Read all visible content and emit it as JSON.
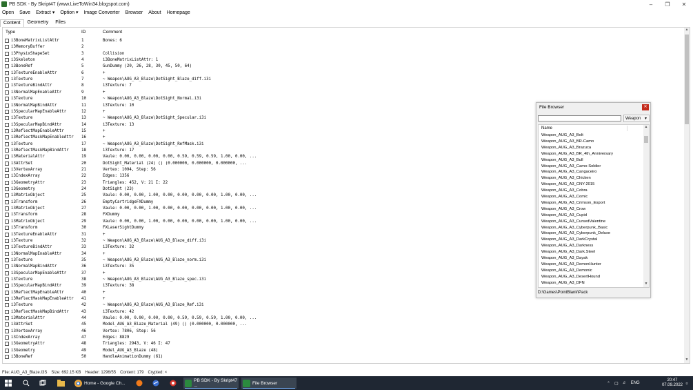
{
  "window": {
    "title": "PB SDK - By Skript47 (www.LiveToWin34.blogspot.com)"
  },
  "menu": [
    "Open",
    "Save",
    "Extract",
    "Option",
    "Image Converter",
    "Browser",
    "About",
    "Homepage"
  ],
  "tabs": [
    "Content",
    "Geometry",
    "Files"
  ],
  "columns": {
    "type": "Type",
    "id": "ID",
    "comment": "Comment"
  },
  "rows": [
    {
      "type": "i3BoneMatrixListAttr",
      "id": "1",
      "comment": "Bones: 6"
    },
    {
      "type": "i3MemoryBuffer",
      "id": "2",
      "comment": ""
    },
    {
      "type": "i3PhysixShapeSet",
      "id": "3",
      "comment": "Collision"
    },
    {
      "type": "i3Skeleton",
      "id": "4",
      "comment": "i3BoneMatrixListAttr: 1"
    },
    {
      "type": "i3BoneRef",
      "id": "5",
      "comment": "GunDummy (20, 26, 28, 30, 45, 50, 64)"
    },
    {
      "type": "i3TextureEnableAttr",
      "id": "6",
      "comment": "+"
    },
    {
      "type": "i3Texture",
      "id": "7",
      "comment": "~ Weapon\\AUG_A3_Blaze\\DotSight_Blaze_diff.i3i"
    },
    {
      "type": "i3TextureBindAttr",
      "id": "8",
      "comment": "i3Texture: 7"
    },
    {
      "type": "i3NormalMapEnableAttr",
      "id": "9",
      "comment": "+"
    },
    {
      "type": "i3Texture",
      "id": "10",
      "comment": "~ Weapon\\AUG_A3_Blaze\\DotSight_Normal.i3i"
    },
    {
      "type": "i3NormalMapBindAttr",
      "id": "11",
      "comment": "i3Texture: 10"
    },
    {
      "type": "i3SpecularMapEnableAttr",
      "id": "12",
      "comment": "+"
    },
    {
      "type": "i3Texture",
      "id": "13",
      "comment": "~ Weapon\\AUG_A3_Blaze\\DotSight_Specular.i3i"
    },
    {
      "type": "i3SpecularMapBindAttr",
      "id": "14",
      "comment": "i3Texture: 13"
    },
    {
      "type": "i3ReflectMapEnableAttr",
      "id": "15",
      "comment": "+"
    },
    {
      "type": "i3ReflectMaskMapEnableAttr",
      "id": "16",
      "comment": "+"
    },
    {
      "type": "i3Texture",
      "id": "17",
      "comment": "~ Weapon\\AUG_A3_Blaze\\DotSight_RefMask.i3i"
    },
    {
      "type": "i3ReflectMaskMapBindAttr",
      "id": "18",
      "comment": "i3Texture: 17"
    },
    {
      "type": "i3MaterialAttr",
      "id": "19",
      "comment": "Vaule: 0.00, 0.00, 0.00, 0.00, 0.59, 0.59, 0.59, 1.00, 0.00, ..."
    },
    {
      "type": "i3AttrSet",
      "id": "20",
      "comment": "DotSight_Material (24) () (0.000000, 0.000000, 0.000000, ..."
    },
    {
      "type": "i3VertexArray",
      "id": "21",
      "comment": "Vertex: 1094, Step: 56"
    },
    {
      "type": "i3IndexArray",
      "id": "22",
      "comment": "Edges: 1356"
    },
    {
      "type": "i3GeometryAttr",
      "id": "23",
      "comment": "Triangles: 452, V: 21 I: 22"
    },
    {
      "type": "i3Geometry",
      "id": "24",
      "comment": "DotSight (23)"
    },
    {
      "type": "i3MatrixObject",
      "id": "25",
      "comment": "Vaule: 0.00, 0.00, 1.00, 0.00, 0.00, 0.00, 0.00, 1.00, 0.00, ..."
    },
    {
      "type": "i3Transform",
      "id": "26",
      "comment": "EmptyCartridgeFXDummy"
    },
    {
      "type": "i3MatrixObject",
      "id": "27",
      "comment": "Vaule: 0.00, 0.00, 1.00, 0.00, 0.00, 0.00, 0.00, 1.00, 0.00, ..."
    },
    {
      "type": "i3Transform",
      "id": "28",
      "comment": "FXDummy"
    },
    {
      "type": "i3MatrixObject",
      "id": "29",
      "comment": "Vaule: 0.00, 0.00, 1.00, 0.00, 0.00, 0.00, 0.00, 1.00, 0.00, ..."
    },
    {
      "type": "i3Transform",
      "id": "30",
      "comment": "FXLaserSightDummy"
    },
    {
      "type": "i3TextureEnableAttr",
      "id": "31",
      "comment": "+"
    },
    {
      "type": "i3Texture",
      "id": "32",
      "comment": "~ Weapon\\AUG_A3_Blaze\\AUG_A3_Blaze_diff.i3i"
    },
    {
      "type": "i3TextureBindAttr",
      "id": "33",
      "comment": "i3Texture: 32"
    },
    {
      "type": "i3NormalMapEnableAttr",
      "id": "34",
      "comment": "+"
    },
    {
      "type": "i3Texture",
      "id": "35",
      "comment": "~ Weapon\\AUG_A3_Blaze\\AUG_A3_Blaze_norm.i3i"
    },
    {
      "type": "i3NormalMapBindAttr",
      "id": "36",
      "comment": "i3Texture: 35"
    },
    {
      "type": "i3SpecularMapEnableAttr",
      "id": "37",
      "comment": "+"
    },
    {
      "type": "i3Texture",
      "id": "38",
      "comment": "~ Weapon\\AUG_A3_Blaze\\AUG_A3_Blaze_spec.i3i"
    },
    {
      "type": "i3SpecularMapBindAttr",
      "id": "39",
      "comment": "i3Texture: 38"
    },
    {
      "type": "i3ReflectMapEnableAttr",
      "id": "40",
      "comment": "+"
    },
    {
      "type": "i3ReflectMaskMapEnableAttr",
      "id": "41",
      "comment": "+"
    },
    {
      "type": "i3Texture",
      "id": "42",
      "comment": "~ Weapon\\AUG_A3_Blaze\\AUG_A3_Blaze_Ref.i3i"
    },
    {
      "type": "i3ReflectMaskMapBindAttr",
      "id": "43",
      "comment": "i3Texture: 42"
    },
    {
      "type": "i3MaterialAttr",
      "id": "44",
      "comment": "Vaule: 0.00, 0.00, 0.00, 0.00, 0.59, 0.59, 0.59, 1.00, 0.00, ..."
    },
    {
      "type": "i3AttrSet",
      "id": "45",
      "comment": "Model_AUG_A3_Blaze_Material (49) () (0.000000, 0.000000, ..."
    },
    {
      "type": "i3VertexArray",
      "id": "46",
      "comment": "Vertex: 7806, Step: 56"
    },
    {
      "type": "i3IndexArray",
      "id": "47",
      "comment": "Edges: 8829"
    },
    {
      "type": "i3GeometryAttr",
      "id": "48",
      "comment": "Triangles: 2943, V: 46 I: 47"
    },
    {
      "type": "i3Geometry",
      "id": "49",
      "comment": "Model_AUG_A3_Blaze (48)"
    },
    {
      "type": "i3BoneRef",
      "id": "50",
      "comment": "HandleAnimationDummy (61)"
    }
  ],
  "status": {
    "file": "File: AUG_A3_Blaze.I3S",
    "size": "Size: 692.15 KB",
    "header": "Header: 1296/55",
    "content": "Content: 179",
    "crypted": "Crypted: ×"
  },
  "file_browser": {
    "title": "File Browser",
    "search_value": "",
    "filter": "Weapon",
    "column": "Name",
    "items": [
      "Weapon_AUG_A3_Bolt",
      "Weapon_AUG_A3_BR-Camo",
      "Weapon_AUG_A3_Brazuca",
      "Weapon_AUG_A3_BR_4th_Anniversary",
      "Weapon_AUG_A3_Bull",
      "Weapon_AUG_A3_Camo-Soldier",
      "Weapon_AUG_A3_Cangaceiro",
      "Weapon_AUG_A3_Chicken",
      "Weapon_AUG_A3_CNY-2015",
      "Weapon_AUG_A3_Cobra",
      "Weapon_AUG_A3_Comic",
      "Weapon_AUG_A3_Crimson_Esport",
      "Weapon_AUG_A3_Crow",
      "Weapon_AUG_A3_Cupid",
      "Weapon_AUG_A3_CursedValentine",
      "Weapon_AUG_A3_Cyberpunk_Basic",
      "Weapon_AUG_A3_Cyberpunk_Deluxe",
      "Weapon_AUG_A3_DarkCrystal",
      "Weapon_AUG_A3_Darkness",
      "Weapon_AUG_A3_Dark.Steel",
      "Weapon_AUG_A3_Dayak",
      "Weapon_AUG_A3_DemonHunter",
      "Weapon_AUG_A3_Demonic",
      "Weapon_AUG_A3_DesertHound",
      "Weapon_AUG_A3_DFN"
    ],
    "path": "D:\\Games\\PointBlank\\Pack"
  },
  "taskbar": {
    "apps": [
      {
        "label": "Home - Google Ch...",
        "color": "#e8a33c"
      },
      {
        "label": "PB SDK - By Skript47 ...",
        "color": "#2b8a3e"
      },
      {
        "label": "File Browser",
        "color": "#2b8a3e"
      }
    ],
    "lang": "ENG",
    "time": "20:47",
    "date": "07.09.2022"
  },
  "icons": {
    "minimize": "minimize-icon",
    "maximize": "maximize-icon",
    "close": "close-icon",
    "start": "windows-start-icon",
    "search": "search-icon",
    "taskview": "task-view-icon"
  }
}
